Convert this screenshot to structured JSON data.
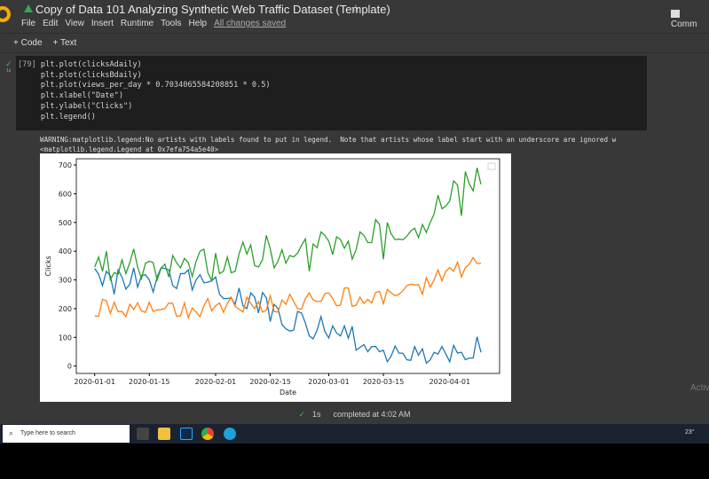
{
  "header": {
    "title": "Copy of Data 101 Analyzing Synthetic Web Traffic Dataset (Template)",
    "menu": [
      "File",
      "Edit",
      "View",
      "Insert",
      "Runtime",
      "Tools",
      "Help"
    ],
    "save_status": "All changes saved",
    "comment_label": "Comm"
  },
  "toolbar": {
    "code_label": "+ Code",
    "text_label": "+ Text"
  },
  "cell": {
    "exec_count": "[79]",
    "run_time": "1s",
    "lines": [
      "plt.plot(clicksAdaily)",
      "plt.plot(clicksBdaily)",
      "plt.plot(views_per_day * 0.7034065584208851 * 0.5)",
      "plt.xlabel(\"Date\")",
      "plt.ylabel(\"Clicks\")",
      "plt.legend()"
    ]
  },
  "output": {
    "warning": "WARNING:matplotlib.legend:No artists with labels found to put in legend.  Note that artists whose label start with an underscore are ignored w",
    "repr": "<matplotlib.legend.Legend at 0x7efa754a5e40>"
  },
  "chart_data": {
    "type": "line",
    "xlabel": "Date",
    "ylabel": "Clicks",
    "x_start": "2020-01-01",
    "x_step": "1 day",
    "xticks": [
      "2020-01-01",
      "2020-01-15",
      "2020-02-01",
      "2020-02-15",
      "2020-03-01",
      "2020-03-15",
      "2020-04-01"
    ],
    "yticks": [
      0,
      100,
      200,
      300,
      400,
      500,
      600,
      700
    ],
    "ylim": [
      -25,
      745
    ],
    "legend": "top-right (empty)",
    "grid": false,
    "series": [
      {
        "color": "#1f77b4",
        "values": [
          340,
          320,
          280,
          330,
          315,
          250,
          335,
          310,
          268,
          285,
          342,
          275,
          315,
          318,
          300,
          258,
          310,
          342,
          340,
          335,
          280,
          270,
          322,
          322,
          335,
          265,
          300,
          318,
          290,
          292,
          297,
          310,
          250,
          235,
          235,
          238,
          215,
          272,
          210,
          200,
          255,
          240,
          185,
          256,
          238,
          155,
          215,
          200,
          145,
          130,
          122,
          125,
          190,
          185,
          150,
          105,
          95,
          125,
          172,
          120,
          98,
          140,
          115,
          105,
          140,
          97,
          138,
          55,
          65,
          75,
          50,
          68,
          68,
          50,
          55,
          15,
          35,
          70,
          45,
          45,
          22,
          20,
          68,
          38,
          60,
          10,
          22,
          48,
          42,
          68,
          42,
          15,
          72,
          45,
          48,
          22,
          28,
          28,
          102,
          48
        ]
      },
      {
        "color": "#ff7f0e",
        "values": [
          175,
          173,
          232,
          228,
          183,
          222,
          190,
          190,
          172,
          215,
          197,
          220,
          192,
          187,
          222,
          190,
          195,
          197,
          200,
          220,
          218,
          173,
          175,
          220,
          168,
          202,
          188,
          172,
          210,
          235,
          192,
          210,
          220,
          187,
          218,
          240,
          208,
          198,
          188,
          240,
          218,
          200,
          225,
          188,
          195,
          245,
          190,
          188,
          230,
          215,
          250,
          225,
          200,
          198,
          235,
          255,
          230,
          225,
          225,
          252,
          255,
          235,
          210,
          212,
          272,
          272,
          208,
          212,
          240,
          218,
          232,
          220,
          256,
          260,
          217,
          267,
          255,
          245,
          250,
          262,
          280,
          285,
          283,
          283,
          250,
          308,
          275,
          300,
          335,
          297,
          330,
          343,
          330,
          362,
          310,
          343,
          355,
          378,
          357,
          358
        ]
      },
      {
        "color": "#2ca02c",
        "values": [
          345,
          380,
          330,
          400,
          300,
          325,
          320,
          370,
          322,
          360,
          408,
          345,
          305,
          358,
          365,
          360,
          300,
          340,
          355,
          310,
          385,
          360,
          342,
          375,
          360,
          312,
          365,
          400,
          407,
          325,
          298,
          393,
          322,
          330,
          380,
          325,
          330,
          390,
          432,
          390,
          422,
          350,
          345,
          370,
          455,
          408,
          342,
          365,
          405,
          358,
          385,
          380,
          393,
          420,
          443,
          330,
          425,
          412,
          467,
          455,
          435,
          388,
          450,
          440,
          410,
          435,
          372,
          405,
          467,
          455,
          430,
          430,
          510,
          493,
          372,
          500,
          460,
          440,
          442,
          440,
          452,
          470,
          480,
          447,
          493,
          465,
          500,
          530,
          595,
          548,
          557,
          575,
          645,
          630,
          523,
          677,
          635,
          610,
          690,
          633
        ]
      }
    ]
  },
  "status": {
    "duration": "1s",
    "completed": "completed at 4:02 AM"
  },
  "taskbar": {
    "search_placeholder": "Type here to search",
    "temperature": "23°"
  },
  "watermark": "Activ"
}
